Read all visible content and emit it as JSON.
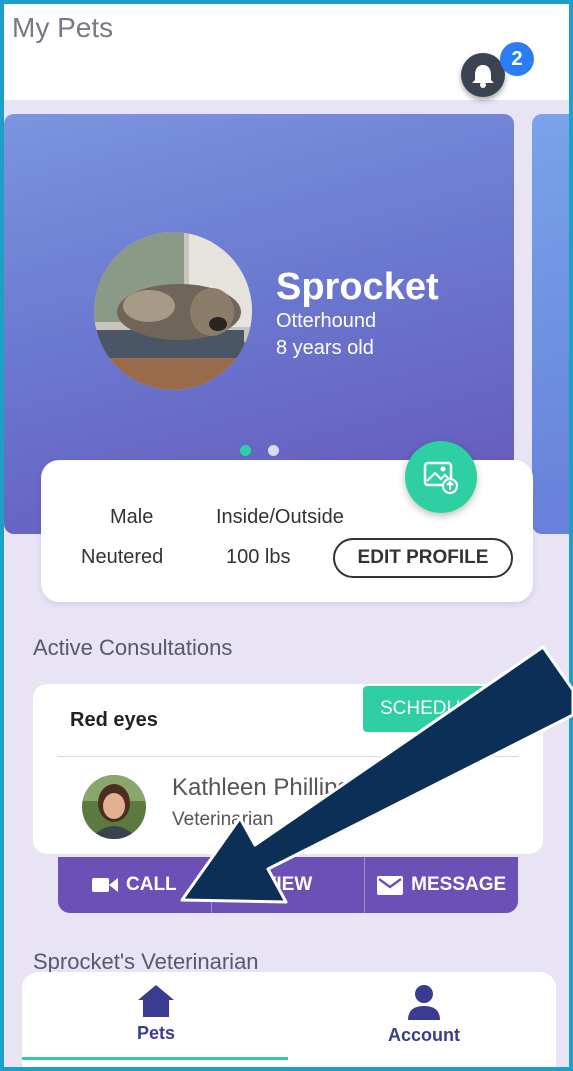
{
  "header": {
    "title": "My Pets",
    "notification_count": "2"
  },
  "pet": {
    "name": "Sprocket",
    "breed": "Otterhound",
    "age": "8 years old",
    "sex": "Male",
    "environment": "Inside/Outside",
    "fixed": "Neutered",
    "weight": "100 lbs",
    "edit_label": "EDIT PROFILE"
  },
  "carousel": {
    "pages": 2,
    "active_page": 1
  },
  "consultations": {
    "section_title": "Active Consultations",
    "item": {
      "title": "Red eyes",
      "status": "SCHEDULED",
      "vet_name": "Kathleen Phillips",
      "vet_role": "Veterinarian"
    },
    "actions": {
      "call": "CALL",
      "view": "VIEW",
      "message": "MESSAGE"
    }
  },
  "vet_section": {
    "title": "Sprocket's Veterinarian"
  },
  "nav": {
    "pets": "Pets",
    "account": "Account"
  },
  "colors": {
    "accent": "#2ecfa3",
    "primary": "#6b50b6",
    "badge": "#2a7df4",
    "annotation_arrow": "#0c2f57"
  }
}
